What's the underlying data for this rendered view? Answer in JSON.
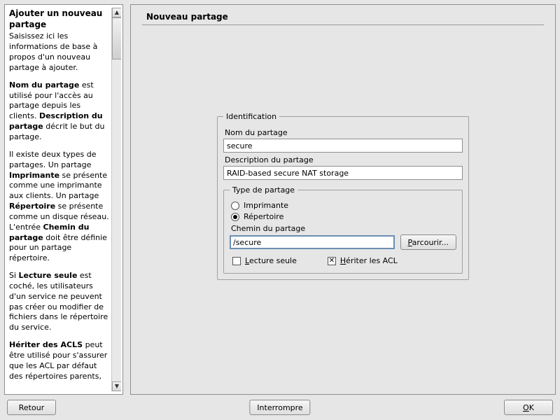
{
  "help": {
    "title": "Ajouter un nouveau partage",
    "intro": "Saisissez ici les informations de base à propos d'un nouveau partage à ajouter.",
    "p2_a": "Nom du partage",
    "p2_b": " est utilisé pour l'accès au partage depuis les clients. ",
    "p2_c": "Description du partage",
    "p2_d": " décrit le but du partage.",
    "p3_a": "Il existe deux types de partages. Un partage ",
    "p3_b": "Imprimante",
    "p3_c": " se présente comme une imprimante aux clients. Un partage ",
    "p3_d": "Répertoire",
    "p3_e": " se présente comme un disque réseau. L'entrée ",
    "p3_f": "Chemin du partage",
    "p3_g": " doit être définie pour un partage répertoire.",
    "p4_a": "Si ",
    "p4_b": "Lecture seule",
    "p4_c": " est coché, les utilisateurs d'un service ne peuvent pas créer ou modifier de fichiers dans le répertoire du service.",
    "p5_a": "Hériter des ACLS",
    "p5_b": " peut être utilisé pour s'assurer que les ACL par défaut des répertoires parents,"
  },
  "page": {
    "title": "Nouveau partage"
  },
  "form": {
    "ident_legend": "Identification",
    "name_label": "Nom du partage",
    "name_value": "secure",
    "desc_label": "Description du partage",
    "desc_value": "RAID-based secure NAT storage",
    "type_legend": "Type de partage",
    "radio_printer": "Imprimante",
    "radio_dir": "Répertoire",
    "path_label": "Chemin du partage",
    "path_value": "/secure",
    "browse_btn": "Parcourir...",
    "browse_access": "P",
    "readonly_label": "Lecture seule",
    "readonly_access": "L",
    "inherit_label": "Hériter les ACL",
    "inherit_access": "H",
    "inherit_checked": true
  },
  "buttons": {
    "back": "Retour",
    "abort": "Interrompre",
    "ok": "OK",
    "ok_access": "O"
  }
}
